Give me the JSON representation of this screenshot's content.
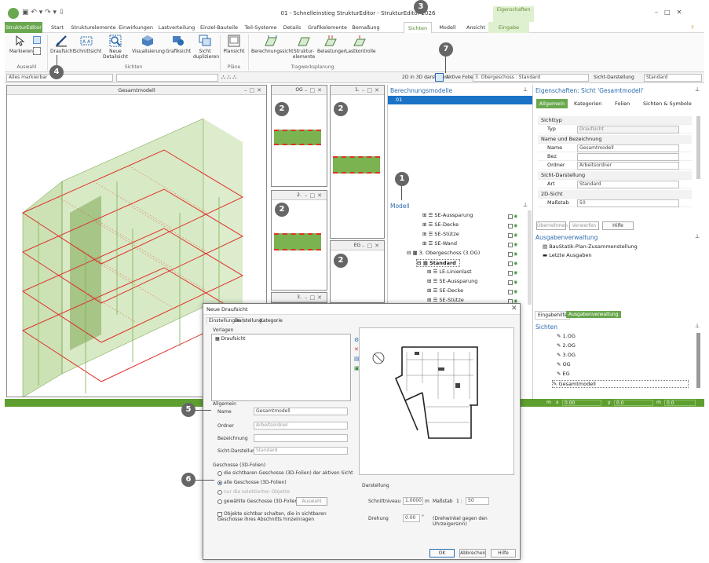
{
  "app": {
    "window_title": "01 - Schnelleinstieg StrukturEditor - StrukturEditor 2026",
    "context_group": "Eigenschaften",
    "window_controls": [
      "–",
      "□",
      "✕"
    ],
    "help_glyph": "?"
  },
  "tabs": [
    {
      "label": "StrukturEditor"
    },
    {
      "label": "Start"
    },
    {
      "label": "Strukturelemente"
    },
    {
      "label": "Einwirkungen"
    },
    {
      "label": "Lastverteilung"
    },
    {
      "label": "Einzel-Bauteile"
    },
    {
      "label": "Teil-Systeme"
    },
    {
      "label": "Details"
    },
    {
      "label": "Grafikelemente"
    },
    {
      "label": "Bemaßung"
    },
    {
      "label": "Sichten"
    },
    {
      "label": "Modell"
    },
    {
      "label": "Ansicht"
    },
    {
      "label": "Eingabe"
    }
  ],
  "ribbon": {
    "auswahl": {
      "group": "Auswahl",
      "markieren": "Markieren"
    },
    "sichten": {
      "group": "Sichten",
      "draufsicht": "Draufsicht",
      "schnittsicht": "Schnittsicht",
      "neue_detailsicht": "Neue Detailsicht",
      "visualisierung": "Visualisierung",
      "grafiksicht": "Grafiksicht",
      "sicht_duplizieren": "Sicht duplizieren"
    },
    "plaene": {
      "group": "Pläne",
      "plansicht": "Plansicht"
    },
    "tragwerk": {
      "group": "Tragwerksplanung",
      "berechnungssicht": "Berechnungssicht",
      "strukturelemente": "Struktur-elemente",
      "belastungen": "Belastungen",
      "lastkontrolle": "Lastkontrolle"
    }
  },
  "toolbar": {
    "filter_value": "Alles markierbar",
    "label_2d3d": "2D in 3D darstellen:",
    "aktive_folie_label": "Aktive Folie:",
    "aktive_folie_value": "3. Obergeschoss : Standard",
    "sicht_darstellung_label": "Sicht-Darstellung",
    "sicht_darstellung_value": "Standard"
  },
  "views": {
    "main_title": "Gesamtmodell",
    "small_titles": [
      "OG",
      "1.",
      "2.",
      "EG",
      "3."
    ]
  },
  "badges": [
    "1",
    "2",
    "2",
    "2",
    "2",
    "3",
    "4",
    "5",
    "6",
    "7"
  ],
  "berechnungsmodelle": {
    "title": "Berechnungsmodelle",
    "item": "01"
  },
  "modell": {
    "title": "Modell",
    "rows": [
      {
        "label": "SE-Aussparung"
      },
      {
        "label": "SE-Decke"
      },
      {
        "label": "SE-Stütze"
      },
      {
        "label": "SE-Wand"
      },
      {
        "label": "3. Obergeschoss (3.OG)"
      },
      {
        "label": "Standard"
      },
      {
        "label": "LE-Linienlast"
      },
      {
        "label": "SE-Aussparung"
      },
      {
        "label": "SE-Decke"
      },
      {
        "label": "SE-Stütze"
      }
    ]
  },
  "eigenschaften": {
    "title": "Eigenschaften: Sicht 'Gesamtmodell'",
    "tabs": [
      "Allgemein",
      "Kategorien",
      "Folien",
      "Sichten & Symbole"
    ],
    "sichttyp": "Sichttyp",
    "typ_label": "Typ",
    "typ_value": "Draufsicht",
    "name_section": "Name und Bezeichnung",
    "name_label": "Name",
    "name_value": "Gesamtmodell",
    "bez_label": "Bez",
    "ordner_label": "Ordner",
    "ordner_value": "Arbeitsordner",
    "sicht_darst_section": "Sicht-Darstellung",
    "art_label": "Art",
    "art_value": "Standard",
    "sicht2d_section": "2D-Sicht",
    "massstab_label": "Maßstab",
    "massstab_value": "50",
    "btn_uebernehmen": "Übernehmen",
    "btn_verwerfen": "Verwerfen",
    "btn_hilfe": "Hilfe"
  },
  "ausgabe": {
    "title": "Ausgabenverwaltung",
    "items": [
      "BauStatik-Plan-Zusammenstellung",
      "Letzte Ausgaben"
    ]
  },
  "bottom_tabs": [
    "Eingabehilfe",
    "Ausgabenverwaltung"
  ],
  "sichten_panel": {
    "title": "Sichten",
    "items": [
      "1.OG",
      "2.OG",
      "3.OG",
      "OG",
      "EG",
      "Gesamtmodell"
    ]
  },
  "statusbar": {
    "m_label": "m",
    "x_label": "x",
    "x_value": "0.00",
    "y_label": "y",
    "y_value": "0.0",
    "dx_label": "m",
    "dx_value": "0.0"
  },
  "dialog": {
    "title": "Neue Draufsicht",
    "tabs": [
      "Einstellungen",
      "Darstellung",
      "Kategorie"
    ],
    "vorlagen_label": "Vorlagen",
    "vorlagen_item": "Draufsicht",
    "allgemein": "Allgemein",
    "name_label": "Name",
    "name_value": "Gesamtmodell",
    "ordner_label": "Ordner",
    "ordner_value": "Arbeitsordner",
    "bezeichnung_label": "Bezeichnung",
    "sicht_darst_label": "Sicht-Darstellung",
    "sicht_darst_value": "Standard",
    "geschosse_section": "Geschosse (3D-Folien)",
    "opt1": "die sichtbaren Geschosse (3D-Folien) der aktiven Sicht",
    "opt2": "alle Geschosse (3D-Folien)",
    "opt3": "nur die selektierten Objekte",
    "opt4": "gewählte Geschosse (3D-Folien)",
    "auswahl_btn": "Auswahl",
    "checkbox_text": "Objekte sichtbar schalten, die in sichtbaren Geschosse ihres Abschnitts hinzeinragen",
    "darstellung_section": "Darstellung",
    "schnittniveau_label": "Schnittniveau",
    "schnittniveau_value": "1.0000",
    "schnittniveau_unit": "m",
    "massstab_label": "Maßstab",
    "massstab_prefix": "1 :",
    "massstab_value": "50",
    "drehung_label": "Drehung",
    "drehung_value": "0.00",
    "drehung_unit": "°",
    "drehung_note": "(Drehwinkel gegen den Uhrzeigersinn)",
    "ok": "OK",
    "abbrechen": "Abbrechen",
    "hilfe": "Hilfe"
  },
  "colors": {
    "accent_green": "#6aa84f",
    "slab_red": "#e0302a",
    "wall_green": "#8fbf5a",
    "selection_blue": "#1a73c7",
    "badge_gray": "#666666"
  }
}
